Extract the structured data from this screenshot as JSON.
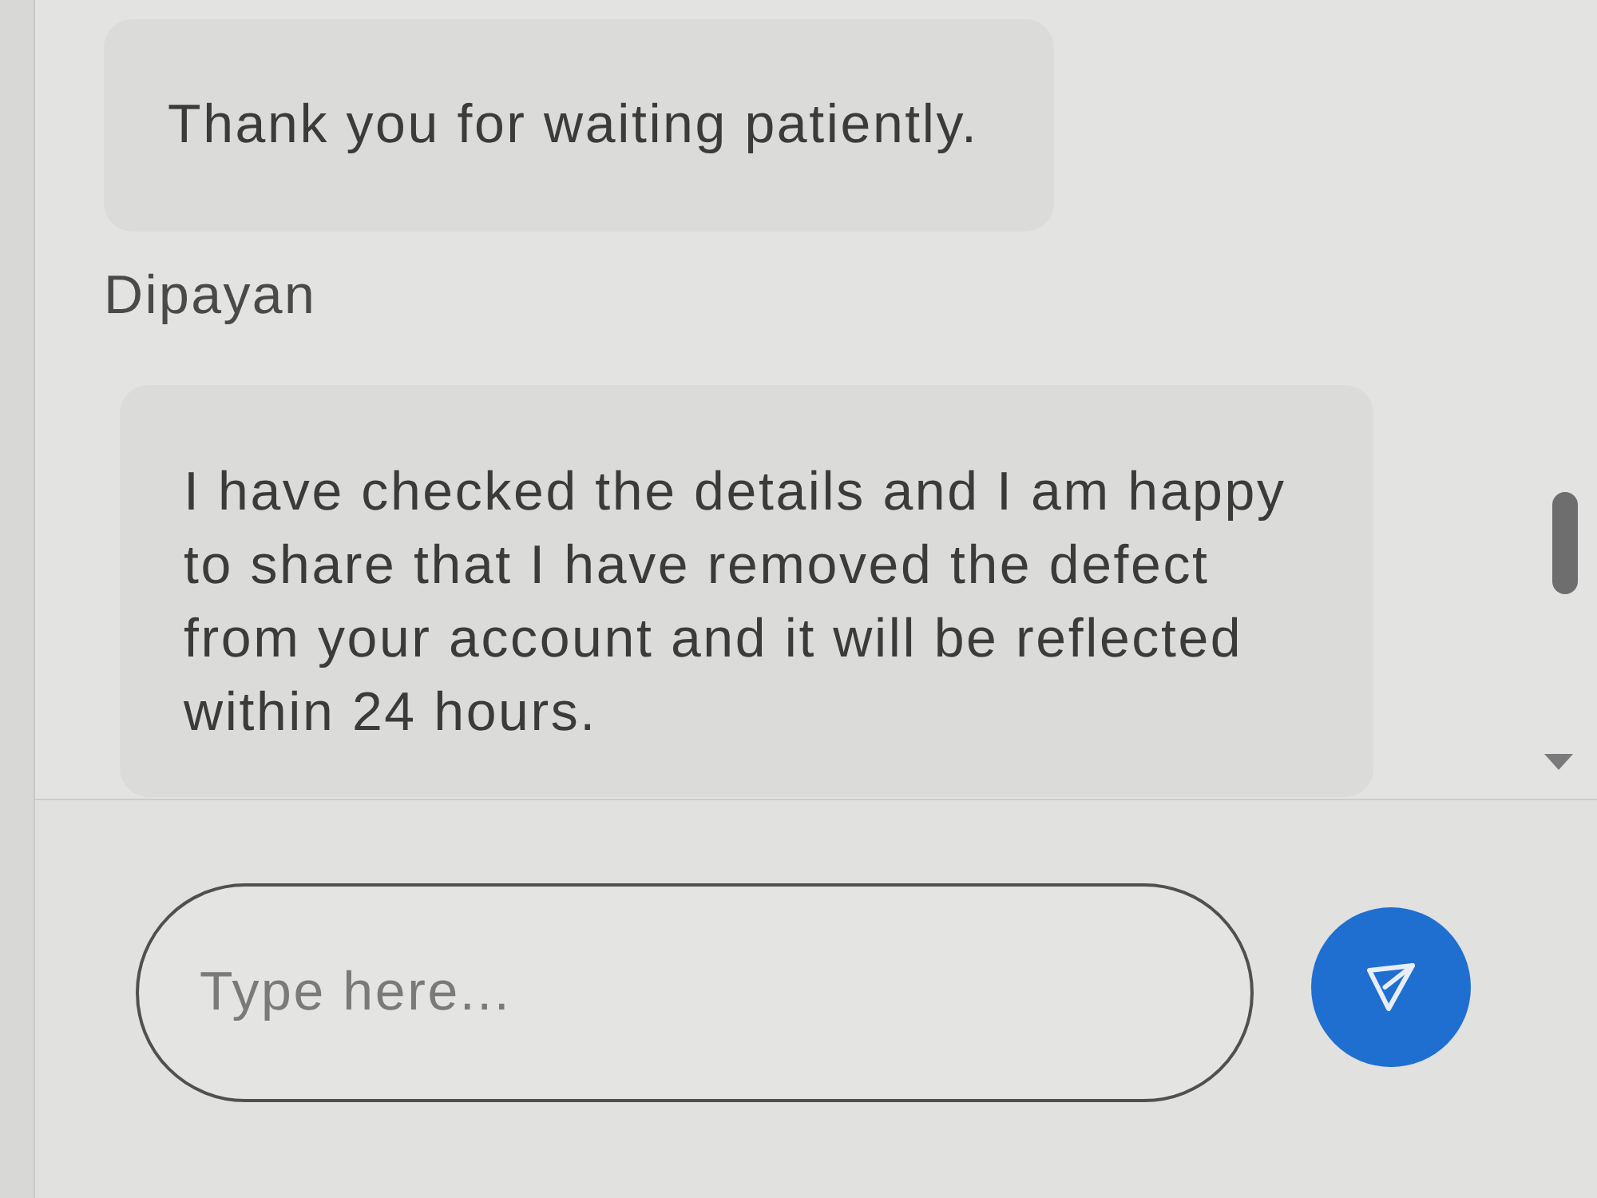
{
  "messages": [
    {
      "text": "Thank you for waiting patiently."
    },
    {
      "sender": "Dipayan",
      "text": "I have checked the details and I am happy to share that I have removed the defect from your account and it will be reflected within 24 hours."
    }
  ],
  "composer": {
    "placeholder": "Type here..."
  }
}
